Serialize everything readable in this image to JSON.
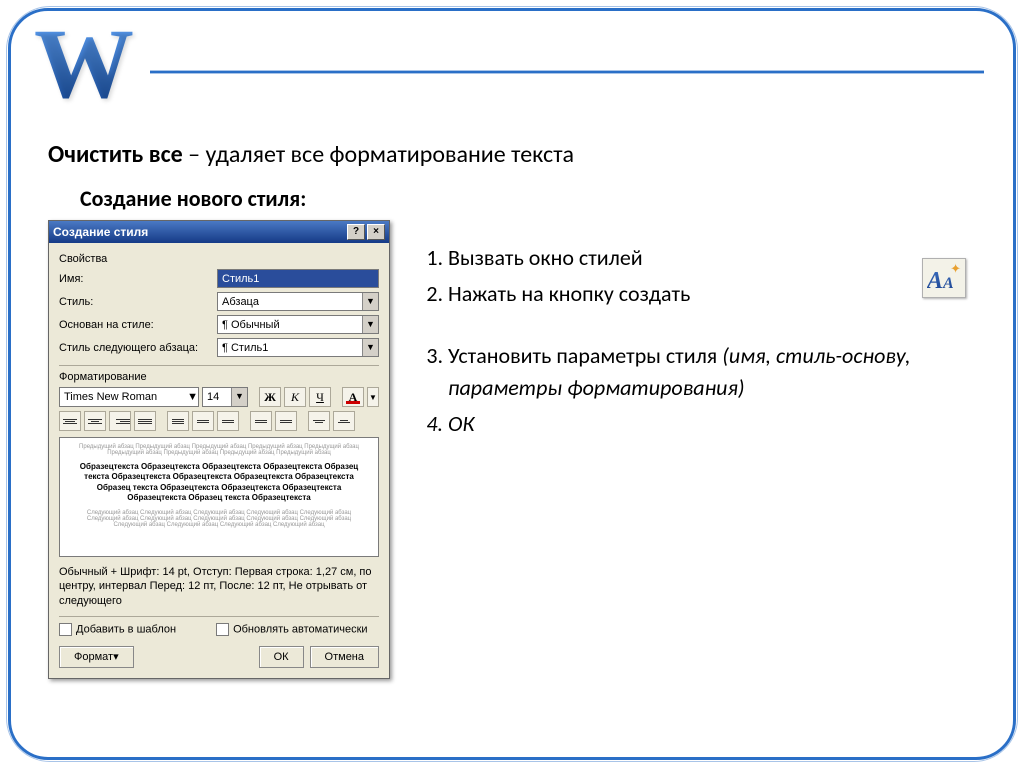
{
  "header": {
    "logo_letter": "W",
    "title_bold": "Очистить все",
    "title_rest": " – удаляет все форматирование текста",
    "subheading": "Создание нового стиля:"
  },
  "dialog": {
    "title": "Создание стиля",
    "group_properties": "Свойства",
    "labels": {
      "name": "Имя:",
      "style": "Стиль:",
      "based_on": "Основан на стиле:",
      "next_para": "Стиль следующего абзаца:"
    },
    "values": {
      "name": "Стиль1",
      "style": "Абзаца",
      "based_on": "¶ Обычный",
      "next_para": "¶ Стиль1"
    },
    "group_formatting": "Форматирование",
    "font_name": "Times New Roman",
    "font_size": "14",
    "bold": "Ж",
    "italic": "К",
    "underline": "Ч",
    "colorA": "A",
    "preview_dark": "Образецтекста Образецтекста Образецтекста Образецтекста Образец текста Образецтекста Образецтекста Образецтекста Образецтекста Образец текста Образецтекста Образецтекста Образецтекста Образецтекста Образец текста Образецтекста",
    "summary": "Обычный + Шрифт: 14 pt, Отступ: Первая строка: 1,27 см, по центру, интервал Перед: 12 пт, После: 12 пт, Не отрывать от следующего",
    "chk_template": "Добавить в шаблон",
    "chk_autoupdate": "Обновлять автоматически",
    "btn_format": "Формат",
    "btn_ok": "ОК",
    "btn_cancel": "Отмена"
  },
  "steps": {
    "s1": "Вызвать окно стилей",
    "s2": "Нажать на кнопку создать",
    "s3a": "Установить параметры стиля ",
    "s3b": "(имя, стиль-основу, параметры форматирования)",
    "s4": "ОК"
  },
  "icon_button": {
    "label": "A",
    "sub": "A"
  }
}
